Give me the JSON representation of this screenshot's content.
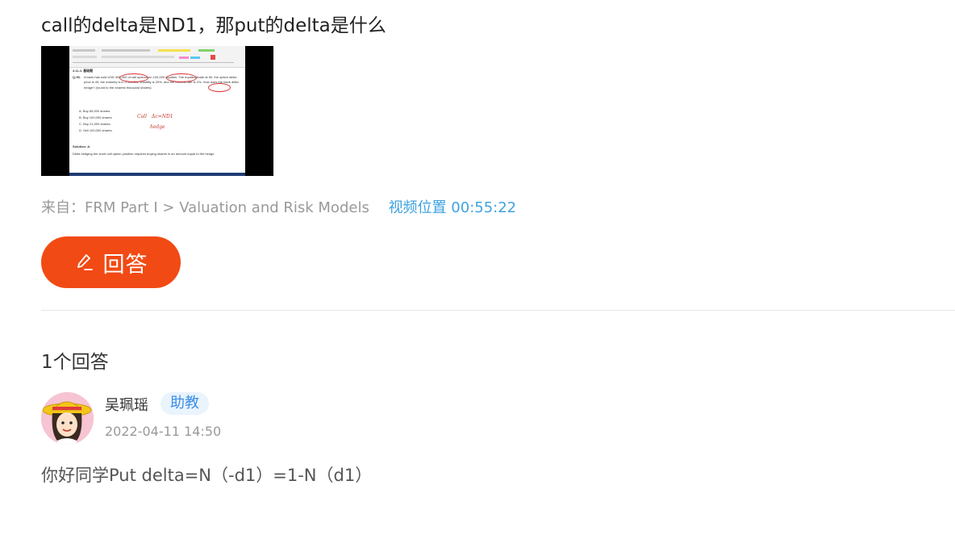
{
  "question": {
    "title": "call的delta是ND1，那put的delta是什么"
  },
  "video_thumbnail": {
    "doc_heading": "4.11.4. 基础题",
    "question_label": "Q-50.",
    "question_text": "A bank has sold USD 300,000 of call options on 100,000 equities. The equities trade at 50, the option strike price is 49, the maturity is in 3 months, volatility is 20%, and the interest rate is 2%. How does the bank delta hedge? (round to the nearest thousand shares)",
    "options": [
      "A.    Buy 65,000 shares.",
      "B.    Buy 100,000 shares.",
      "C.    Buy 21,000 shares.",
      "D.    Sell 100,000 shares."
    ],
    "solution_label": "Solution: A.",
    "solution_text": "Delta hedging the short call option position requires buying shares in an amount equal to the hedge",
    "handwriting": [
      "Call",
      "Δc=ND1",
      "hedge"
    ]
  },
  "source": {
    "label": "来自：FRM Part I > Valuation and Risk Models",
    "video_position": "视频位置 00:55:22"
  },
  "answer_button": {
    "label": "回答",
    "icon": "pencil-icon",
    "color": "#f24a14"
  },
  "answers": {
    "count_label": "1个回答",
    "items": [
      {
        "author": "吴珮瑶",
        "role": "助教",
        "time": "2022-04-11 14:50",
        "content": "你好同学Put delta=N（-d1）=1-N（d1）",
        "avatar": "avatar-icon"
      }
    ]
  },
  "colors": {
    "accent": "#f24a14",
    "link": "#3ea3e0",
    "badge_bg": "#eaf4fd",
    "badge_text": "#3a8ee6"
  }
}
